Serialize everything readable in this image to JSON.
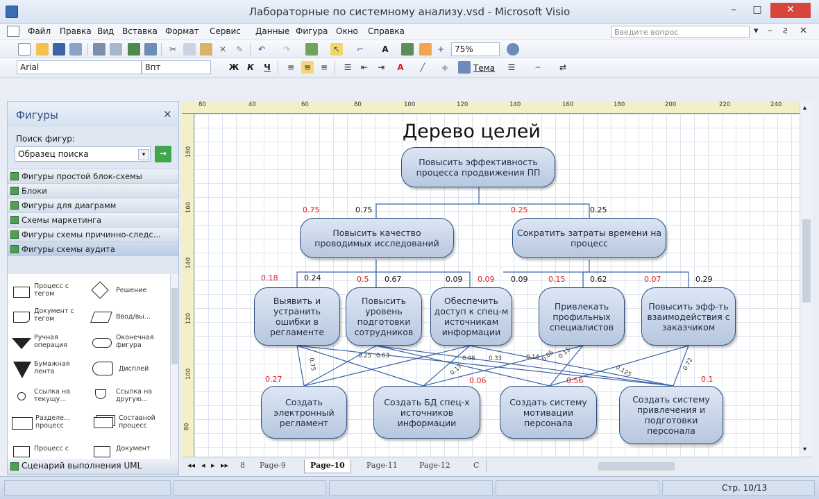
{
  "window": {
    "title": "Лабораторные по системному анализу.vsd - Microsoft Visio",
    "minimize": "–",
    "maximize": "□",
    "close": "✕"
  },
  "menu": {
    "items": [
      "Файл",
      "Правка",
      "Вид",
      "Вставка",
      "Формат",
      "Сервис",
      "Данные",
      "Фигура",
      "Окно",
      "Справка"
    ],
    "help_placeholder": "Введите вопрос",
    "mdi": [
      "▾",
      "–",
      "ƨ",
      "✕"
    ]
  },
  "toolbar": {
    "zoom": "75%",
    "font_name": "Arial",
    "font_size": "8пт",
    "bold": "Ж",
    "italic": "К",
    "underline": "Ч",
    "theme_label": "Тема"
  },
  "shapes_panel": {
    "title": "Фигуры",
    "close": "×",
    "search_label": "Поиск фигур:",
    "search_value": "Образец поиска",
    "stencils": [
      "Фигуры простой блок-схемы",
      "Блоки",
      "Фигуры для диаграмм",
      "Схемы маркетинга",
      "Фигуры схемы причинно-следс...",
      "Фигуры схемы аудита"
    ],
    "items": [
      {
        "label": "Процесс с тегом"
      },
      {
        "label": "Решение"
      },
      {
        "label": "Документ с тегом"
      },
      {
        "label": "Ввод/вы..."
      },
      {
        "label": "Ручная операция"
      },
      {
        "label": "Оконечная фигура"
      },
      {
        "label": "Бумажная лента"
      },
      {
        "label": "Дисплей"
      },
      {
        "label": "Ссылка на текущу..."
      },
      {
        "label": "Ссылка на другую..."
      },
      {
        "label": "Разделе... процесс"
      },
      {
        "label": "Составной процесс"
      },
      {
        "label": "Процесс с"
      },
      {
        "label": "Документ"
      }
    ],
    "bottom_stencil": "Сценарий выполнения UML"
  },
  "ruler": {
    "ticks": [
      "80",
      "40",
      "60",
      "80",
      "100",
      "120",
      "140",
      "160",
      "180",
      "200",
      "220",
      "240"
    ],
    "left_ticks": [
      "180",
      "160",
      "140",
      "120",
      "100",
      "80"
    ]
  },
  "diagram": {
    "title": "Дерево целей",
    "root": "Повысить эффективность процесса продвижения ПП",
    "level1": [
      "Повысить качество проводимых исследований",
      "Сократить затраты времени на процесс"
    ],
    "level2": [
      "Выявить и устранить ошибки в регламенте",
      "Повысить уровень подготовки сотрудников",
      "Обеспечить доступ к спец-м источникам информации",
      "Привлекать профильных специалистов",
      "Повысить эфф-ть взаимодействия с заказчиком"
    ],
    "level3": [
      "Создать электронный регламент",
      "Создать БД спец-х источников информации",
      "Создать систему мотивации персонала",
      "Создать систему привлечения и подготовки персонала"
    ],
    "weights_l1": {
      "red_a": "0.75",
      "black_a": "0.75",
      "red_b": "0.25",
      "black_b": "0.25"
    },
    "weights_l2": {
      "r1": "0.18",
      "b1": "0.24",
      "r2": "0.5",
      "b2": "0.67",
      "b3": "0.09",
      "r3": "0.09",
      "b4": "0.09",
      "r4": "0.15",
      "b5": "0.62",
      "r5": "0.07",
      "b6": "0.29"
    },
    "weights_l3": {
      "r1": "0.27",
      "r2": "0.06",
      "r3": "0.56",
      "r4": "0.1"
    },
    "edge_labels": [
      "0.75",
      "0.25",
      "0.63",
      "0.06",
      "0.33",
      "0.14",
      "0.05",
      "0.15",
      "0.125",
      "0.72",
      "0.17"
    ]
  },
  "pages": {
    "nav": [
      "◂◂",
      "◂",
      "▸",
      "▸▸"
    ],
    "tabs": [
      "8",
      "Page-9",
      "Page-10",
      "Page-11",
      "Page-12",
      "C"
    ],
    "active": "Page-10"
  },
  "status": {
    "page": "Стр. 10/13"
  }
}
